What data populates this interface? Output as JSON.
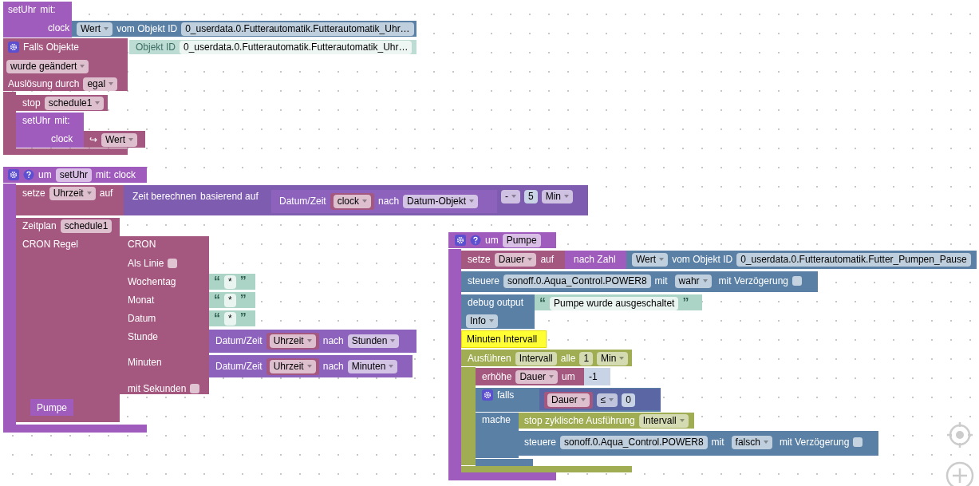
{
  "blocks": [
    {
      "kind": "procedure",
      "lines": [
        {
          "parts": [
            {
              "kind": "label",
              "text": "setUhr"
            },
            {
              "kind": "label",
              "text": "mit:"
            }
          ]
        },
        {
          "parts": [
            {
              "kind": "label",
              "text": "clock"
            }
          ]
        }
      ]
    },
    {
      "kind": "object",
      "lines": [
        {
          "parts": [
            {
              "kind": "dropdown",
              "text": "Wert"
            },
            {
              "kind": "label",
              "text": "vom Objekt ID"
            },
            {
              "kind": "field",
              "text": "0_userdata.0.Futterautomatik.Futterautomatik_Uhr…"
            }
          ]
        }
      ]
    },
    {
      "kind": "event",
      "lines": [
        {
          "parts": [
            {
              "kind": "gear"
            },
            {
              "kind": "label",
              "text": "Falls Objekte"
            }
          ]
        },
        {
          "parts": [
            {
              "kind": "dropdown",
              "text": "wurde geändert"
            }
          ]
        },
        {
          "parts": [
            {
              "kind": "label",
              "text": "Auslösung durch"
            },
            {
              "kind": "dropdown",
              "text": "egal"
            }
          ]
        }
      ]
    },
    {
      "kind": "objectid",
      "lines": [
        {
          "parts": [
            {
              "kind": "label",
              "text": "Objekt ID"
            },
            {
              "kind": "field",
              "text": "0_userdata.0.Futterautomatik.Futterautomatik_Uhr…"
            }
          ]
        }
      ]
    },
    {
      "kind": "event",
      "lines": [
        {
          "parts": [
            {
              "kind": "label",
              "text": "stop"
            },
            {
              "kind": "dropdown",
              "text": "schedule1"
            }
          ]
        }
      ]
    },
    {
      "kind": "procedure",
      "lines": [
        {
          "parts": [
            {
              "kind": "label",
              "text": "setUhr"
            },
            {
              "kind": "label",
              "text": "mit:"
            }
          ]
        },
        {
          "parts": [
            {
              "kind": "label",
              "text": "clock"
            }
          ]
        }
      ]
    },
    {
      "kind": "event",
      "lines": [
        {
          "parts": [
            {
              "kind": "label",
              "text": "↪"
            },
            {
              "kind": "dropdown",
              "text": "Wert"
            }
          ]
        }
      ]
    },
    {
      "kind": "procedure",
      "lines": [
        {
          "parts": [
            {
              "kind": "gear"
            },
            {
              "kind": "help"
            },
            {
              "kind": "label",
              "text": "um"
            },
            {
              "kind": "field",
              "text": "setUhr"
            },
            {
              "kind": "label",
              "text": "mit: clock"
            }
          ]
        }
      ]
    },
    {
      "kind": "event",
      "lines": [
        {
          "parts": [
            {
              "kind": "label",
              "text": "setze"
            },
            {
              "kind": "dropdown",
              "text": "Uhrzeit"
            },
            {
              "kind": "label",
              "text": "auf"
            }
          ]
        }
      ]
    },
    {
      "kind": "datetime",
      "lines": [
        {
          "parts": [
            {
              "kind": "label",
              "text": "Zeit berechnen"
            },
            {
              "kind": "label",
              "text": "basierend auf"
            }
          ]
        },
        {
          "parts": [
            {
              "kind": "dropdown",
              "text": "-"
            },
            {
              "kind": "num",
              "text": "5"
            },
            {
              "kind": "dropdown",
              "text": "Min"
            }
          ]
        }
      ]
    },
    {
      "kind": "date",
      "lines": [
        {
          "parts": [
            {
              "kind": "label",
              "text": "Datum/Zeit"
            },
            {
              "kind": "var",
              "text": "clock"
            },
            {
              "kind": "label",
              "text": "nach"
            },
            {
              "kind": "dropdown",
              "text": "Datum-Objekt"
            }
          ]
        }
      ]
    },
    {
      "kind": "event",
      "lines": [
        {
          "parts": [
            {
              "kind": "label",
              "text": "Zeitplan"
            },
            {
              "kind": "field",
              "text": "schedule1"
            }
          ]
        },
        {
          "parts": [
            {
              "kind": "label",
              "text": "CRON Regel"
            }
          ]
        }
      ]
    },
    {
      "kind": "event",
      "lines": [
        {
          "parts": [
            {
              "kind": "label",
              "text": "CRON"
            }
          ]
        },
        {
          "parts": [
            {
              "kind": "label",
              "text": "Als Linie"
            },
            {
              "kind": "checkbox",
              "checked": false
            }
          ]
        },
        {
          "parts": [
            {
              "kind": "label",
              "text": "Wochentag"
            }
          ]
        },
        {
          "parts": [
            {
              "kind": "label",
              "text": "Monat"
            }
          ]
        },
        {
          "parts": [
            {
              "kind": "label",
              "text": "Datum"
            }
          ]
        },
        {
          "parts": [
            {
              "kind": "label",
              "text": "Stunde"
            }
          ]
        },
        {
          "parts": [
            {
              "kind": "label",
              "text": "Minuten"
            }
          ]
        },
        {
          "parts": [
            {
              "kind": "label",
              "text": "mit Sekunden"
            },
            {
              "kind": "checkbox",
              "checked": false
            }
          ]
        }
      ]
    },
    {
      "kind": "text",
      "lines": [
        {
          "parts": [
            {
              "kind": "quote",
              "text": "“"
            },
            {
              "kind": "field",
              "text": "*"
            },
            {
              "kind": "quote",
              "text": "”"
            }
          ]
        }
      ]
    },
    {
      "kind": "text",
      "lines": [
        {
          "parts": [
            {
              "kind": "quote",
              "text": "“"
            },
            {
              "kind": "field",
              "text": "*"
            },
            {
              "kind": "quote",
              "text": "”"
            }
          ]
        }
      ]
    },
    {
      "kind": "text",
      "lines": [
        {
          "parts": [
            {
              "kind": "quote",
              "text": "“"
            },
            {
              "kind": "field",
              "text": "*"
            },
            {
              "kind": "quote",
              "text": "”"
            }
          ]
        }
      ]
    },
    {
      "kind": "date",
      "lines": [
        {
          "parts": [
            {
              "kind": "label",
              "text": "Datum/Zeit"
            },
            {
              "kind": "var",
              "text": "Uhrzeit"
            },
            {
              "kind": "label",
              "text": "nach"
            },
            {
              "kind": "dropdown",
              "text": "Stunden"
            }
          ]
        }
      ]
    },
    {
      "kind": "date",
      "lines": [
        {
          "parts": [
            {
              "kind": "label",
              "text": "Datum/Zeit"
            },
            {
              "kind": "var",
              "text": "Uhrzeit"
            },
            {
              "kind": "label",
              "text": "nach"
            },
            {
              "kind": "dropdown",
              "text": "Minuten"
            }
          ]
        }
      ]
    },
    {
      "kind": "procedure",
      "lines": [
        {
          "parts": [
            {
              "kind": "label",
              "text": "Pumpe"
            }
          ]
        }
      ]
    },
    {
      "kind": "procedure",
      "lines": [
        {
          "parts": [
            {
              "kind": "gear"
            },
            {
              "kind": "help"
            },
            {
              "kind": "label",
              "text": "um"
            },
            {
              "kind": "field",
              "text": "Pumpe"
            }
          ]
        }
      ]
    },
    {
      "kind": "event",
      "lines": [
        {
          "parts": [
            {
              "kind": "label",
              "text": "setze"
            },
            {
              "kind": "dropdown",
              "text": "Dauer"
            },
            {
              "kind": "label",
              "text": "auf"
            }
          ]
        }
      ]
    },
    {
      "kind": "procedure",
      "lines": [
        {
          "parts": [
            {
              "kind": "label",
              "text": "nach Zahl"
            }
          ]
        }
      ]
    },
    {
      "kind": "object",
      "lines": [
        {
          "parts": [
            {
              "kind": "dropdown",
              "text": "Wert"
            },
            {
              "kind": "label",
              "text": "vom Objekt ID"
            },
            {
              "kind": "field",
              "text": "0_userdata.0.Futterautomatik.Futter_Pumpen_Pause"
            }
          ]
        }
      ]
    },
    {
      "kind": "object",
      "lines": [
        {
          "parts": [
            {
              "kind": "label",
              "text": "steuere"
            },
            {
              "kind": "field",
              "text": "sonoff.0.Aqua_Control.POWER8"
            },
            {
              "kind": "label",
              "text": "mit"
            },
            {
              "kind": "bool",
              "text": "wahr"
            },
            {
              "kind": "label",
              "text": "mit Verzögerung"
            },
            {
              "kind": "checkbox",
              "checked": false
            }
          ]
        }
      ]
    },
    {
      "kind": "object",
      "lines": [
        {
          "parts": [
            {
              "kind": "label",
              "text": "debug output"
            }
          ]
        },
        {
          "parts": [
            {
              "kind": "dropdown",
              "text": "Info"
            }
          ]
        }
      ]
    },
    {
      "kind": "text",
      "lines": [
        {
          "parts": [
            {
              "kind": "quote",
              "text": "“"
            },
            {
              "kind": "field",
              "text": "Pumpe wurde ausgeschaltet"
            },
            {
              "kind": "quote",
              "text": "”"
            }
          ]
        }
      ]
    },
    {
      "kind": "comment",
      "text": "Minuten Intervall"
    },
    {
      "kind": "timer",
      "lines": [
        {
          "parts": [
            {
              "kind": "label",
              "text": "Ausführen"
            },
            {
              "kind": "field",
              "text": "Intervall"
            },
            {
              "kind": "label",
              "text": "alle"
            },
            {
              "kind": "field",
              "text": "1"
            },
            {
              "kind": "dropdown",
              "text": "Min"
            }
          ]
        }
      ]
    },
    {
      "kind": "event",
      "lines": [
        {
          "parts": [
            {
              "kind": "label",
              "text": "erhöhe"
            },
            {
              "kind": "dropdown",
              "text": "Dauer"
            },
            {
              "kind": "label",
              "text": "um"
            }
          ]
        }
      ]
    },
    {
      "kind": "number",
      "lines": [
        {
          "parts": [
            {
              "kind": "label",
              "text": "-1"
            }
          ]
        }
      ]
    },
    {
      "kind": "object",
      "lines": [
        {
          "parts": [
            {
              "kind": "gear"
            },
            {
              "kind": "label",
              "text": "falls"
            }
          ]
        },
        {
          "parts": [
            {
              "kind": "label",
              "text": "mache"
            }
          ]
        }
      ]
    },
    {
      "kind": "compare",
      "lines": [
        {
          "parts": [
            {
              "kind": "var",
              "text": "Dauer"
            },
            {
              "kind": "dropdown",
              "text": "≤"
            },
            {
              "kind": "num",
              "text": "0"
            }
          ]
        }
      ]
    },
    {
      "kind": "timer",
      "lines": [
        {
          "parts": [
            {
              "kind": "label",
              "text": "stop zyklische Ausführung"
            },
            {
              "kind": "dropdown",
              "text": "Intervall"
            }
          ]
        }
      ]
    },
    {
      "kind": "object",
      "lines": [
        {
          "parts": [
            {
              "kind": "label",
              "text": "steuere"
            },
            {
              "kind": "field",
              "text": "sonoff.0.Aqua_Control.POWER8"
            },
            {
              "kind": "label",
              "text": "mit"
            },
            {
              "kind": "bool",
              "text": "falsch"
            },
            {
              "kind": "label",
              "text": "mit Verzögerung"
            },
            {
              "kind": "checkbox",
              "checked": false
            }
          ]
        }
      ]
    }
  ]
}
